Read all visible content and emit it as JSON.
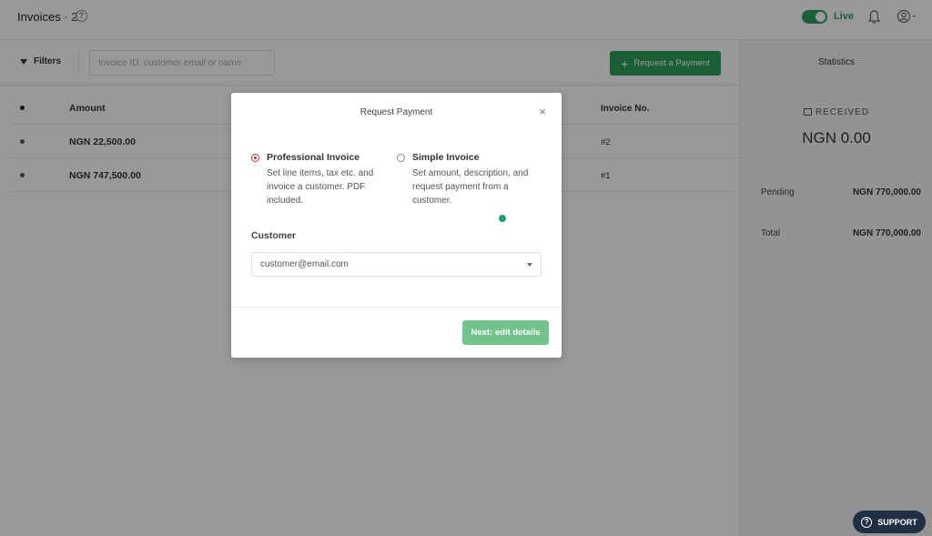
{
  "header": {
    "title": "Invoices",
    "count": "· 2",
    "live_label": "Live"
  },
  "filters": {
    "label": "Filters",
    "search_placeholder": "Invoice ID, customer email or name",
    "request_button": "Request a Payment"
  },
  "table": {
    "columns": {
      "amount": "Amount",
      "invoice_no": "Invoice No."
    },
    "rows": [
      {
        "amount": "NGN 22,500.00",
        "invoice_no": "#2"
      },
      {
        "amount": "NGN 747,500.00",
        "invoice_no": "#1"
      }
    ]
  },
  "stats": {
    "title": "Statistics",
    "received_label": "RECEIVED",
    "received_value": "NGN 0.00",
    "pending_label": "Pending",
    "pending_value": "NGN 770,000.00",
    "total_label": "Total",
    "total_value": "NGN 770,000.00"
  },
  "modal": {
    "title": "Request Payment",
    "close": "×",
    "options": [
      {
        "title": "Professional Invoice",
        "description": "Set line items, tax etc. and invoice a customer. PDF included.",
        "selected": true
      },
      {
        "title": "Simple Invoice",
        "description": "Set amount, description, and request payment from a customer.",
        "selected": false
      }
    ],
    "customer_label": "Customer",
    "customer_value": "customer@email.com",
    "next_button": "Next: edit details"
  },
  "support": {
    "label": "SUPPORT"
  },
  "colors": {
    "accent": "#2e9e5b",
    "radio_selected": "#c9302c",
    "support_bg": "#1f2f44"
  }
}
